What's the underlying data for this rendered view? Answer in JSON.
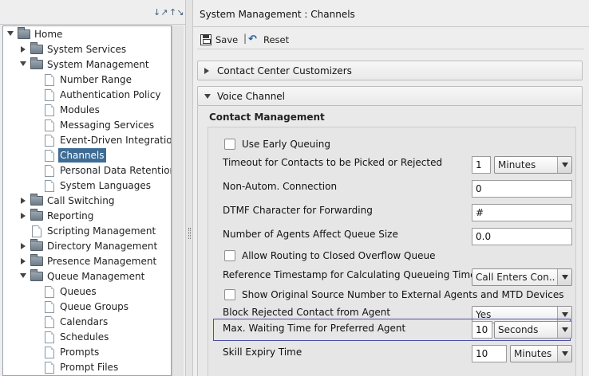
{
  "tree": {
    "items": [
      {
        "label": "Home",
        "level": 0,
        "type": "folder",
        "state": "expanded"
      },
      {
        "label": "System Services",
        "level": 1,
        "type": "folder",
        "state": "collapsed"
      },
      {
        "label": "System Management",
        "level": 1,
        "type": "folder",
        "state": "expanded"
      },
      {
        "label": "Number Range",
        "level": 2,
        "type": "doc"
      },
      {
        "label": "Authentication Policy",
        "level": 2,
        "type": "doc"
      },
      {
        "label": "Modules",
        "level": 2,
        "type": "doc"
      },
      {
        "label": "Messaging Services",
        "level": 2,
        "type": "doc"
      },
      {
        "label": "Event-Driven Integrations",
        "level": 2,
        "type": "doc"
      },
      {
        "label": "Channels",
        "level": 2,
        "type": "doc",
        "selected": true
      },
      {
        "label": "Personal Data Retention T",
        "level": 2,
        "type": "doc"
      },
      {
        "label": "System Languages",
        "level": 2,
        "type": "doc"
      },
      {
        "label": "Call Switching",
        "level": 1,
        "type": "folder",
        "state": "collapsed"
      },
      {
        "label": "Reporting",
        "level": 1,
        "type": "folder",
        "state": "collapsed"
      },
      {
        "label": "Scripting Management",
        "level": 1,
        "type": "doc"
      },
      {
        "label": "Directory Management",
        "level": 1,
        "type": "folder",
        "state": "collapsed"
      },
      {
        "label": "Presence Management",
        "level": 1,
        "type": "folder",
        "state": "collapsed"
      },
      {
        "label": "Queue Management",
        "level": 1,
        "type": "folder",
        "state": "expanded"
      },
      {
        "label": "Queues",
        "level": 2,
        "type": "doc"
      },
      {
        "label": "Queue Groups",
        "level": 2,
        "type": "doc"
      },
      {
        "label": "Calendars",
        "level": 2,
        "type": "doc"
      },
      {
        "label": "Schedules",
        "level": 2,
        "type": "doc"
      },
      {
        "label": "Prompts",
        "level": 2,
        "type": "doc"
      },
      {
        "label": "Prompt Files",
        "level": 2,
        "type": "doc"
      }
    ]
  },
  "toolbar": {
    "expand_icon": "expand-all-icon",
    "collapse_icon": "collapse-all-icon"
  },
  "header": {
    "title": "System Management : Channels"
  },
  "actions": {
    "save_label": "Save",
    "separator": "|",
    "reset_label": "Reset"
  },
  "sections": {
    "customizers": "Contact Center Customizers",
    "voice": "Voice Channel"
  },
  "contact_management": {
    "title": "Contact Management",
    "use_early_queuing": "Use Early Queuing",
    "timeout_label": "Timeout for Contacts to be Picked or Rejected",
    "timeout_value": "1",
    "timeout_unit": "Minutes",
    "non_autom_label": "Non-Autom. Connection",
    "non_autom_value": "0",
    "dtmf_label": "DTMF Character for Forwarding",
    "dtmf_value": "#",
    "agents_queue_label": "Number of Agents Affect Queue Size",
    "agents_queue_value": "0.0",
    "allow_routing_label": "Allow Routing to Closed Overflow Queue",
    "ref_timestamp_label": "Reference Timestamp for Calculating Queueing Time",
    "ref_timestamp_value": "Call Enters Con...",
    "show_original_label": "Show Original Source Number to External Agents and MTD Devices",
    "block_rejected_label": "Block Rejected Contact from Agent",
    "block_rejected_value": "Yes",
    "max_wait_label": "Max. Waiting Time for Preferred Agent",
    "max_wait_value": "10",
    "max_wait_unit": "Seconds",
    "skill_expiry_label": "Skill Expiry Time",
    "skill_expiry_value": "10",
    "skill_expiry_unit": "Minutes"
  }
}
